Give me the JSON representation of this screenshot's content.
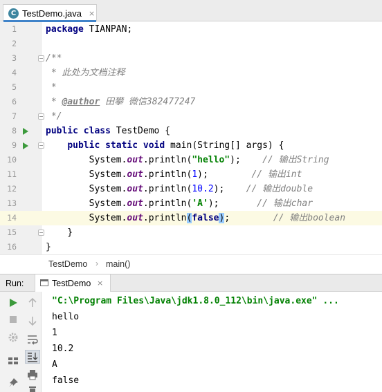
{
  "editor_tab": {
    "icon_letter": "C",
    "label": "TestDemo.java",
    "close": "×"
  },
  "code_lines": [
    {
      "n": "1",
      "segments": [
        [
          "kw",
          "package"
        ],
        [
          "",
          " TIANPAN;"
        ]
      ]
    },
    {
      "n": "2",
      "segments": []
    },
    {
      "n": "3",
      "segments": [
        [
          "doc",
          "/**"
        ]
      ]
    },
    {
      "n": "4",
      "segments": [
        [
          "doc",
          " * 此处为文档注释"
        ]
      ]
    },
    {
      "n": "5",
      "segments": [
        [
          "doc",
          " *"
        ]
      ]
    },
    {
      "n": "6",
      "segments": [
        [
          "doc",
          " * "
        ],
        [
          "doctag",
          "@author"
        ],
        [
          "doc",
          " 田攀 微信382477247"
        ]
      ]
    },
    {
      "n": "7",
      "segments": [
        [
          "doc",
          " */"
        ]
      ]
    },
    {
      "n": "8",
      "segments": [
        [
          "kw",
          "public class"
        ],
        [
          "",
          " TestDemo {"
        ]
      ]
    },
    {
      "n": "9",
      "segments": [
        [
          "",
          "    "
        ],
        [
          "kw",
          "public static void"
        ],
        [
          "",
          " main(String[] args) {"
        ]
      ]
    },
    {
      "n": "10",
      "segments": [
        [
          "",
          "        System."
        ],
        [
          "fld",
          "out"
        ],
        [
          "",
          ".println("
        ],
        [
          "str",
          "\"hello\""
        ],
        [
          "",
          ");    "
        ],
        [
          "cmt",
          "// 输出String"
        ]
      ]
    },
    {
      "n": "11",
      "segments": [
        [
          "",
          "        System."
        ],
        [
          "fld",
          "out"
        ],
        [
          "",
          ".println("
        ],
        [
          "num",
          "1"
        ],
        [
          "",
          ");        "
        ],
        [
          "cmt",
          "// 输出int"
        ]
      ]
    },
    {
      "n": "12",
      "segments": [
        [
          "",
          "        System."
        ],
        [
          "fld",
          "out"
        ],
        [
          "",
          ".println("
        ],
        [
          "num",
          "10.2"
        ],
        [
          "",
          ");    "
        ],
        [
          "cmt",
          "// 输出double"
        ]
      ]
    },
    {
      "n": "13",
      "segments": [
        [
          "",
          "        System."
        ],
        [
          "fld",
          "out"
        ],
        [
          "",
          ".println("
        ],
        [
          "str",
          "'A'"
        ],
        [
          "",
          ");       "
        ],
        [
          "cmt",
          "// 输出char"
        ]
      ]
    },
    {
      "n": "14",
      "segments": [
        [
          "",
          "        System."
        ],
        [
          "fld",
          "out"
        ],
        [
          "",
          ".println"
        ],
        [
          "brace-hl",
          "("
        ],
        [
          "kw",
          "false"
        ],
        [
          "brace-hl",
          ")"
        ],
        [
          "",
          ";        "
        ],
        [
          "cmt",
          "// 输出boolean"
        ]
      ]
    },
    {
      "n": "15",
      "segments": [
        [
          "",
          "    }"
        ]
      ]
    },
    {
      "n": "16",
      "segments": [
        [
          "",
          "}"
        ]
      ]
    }
  ],
  "breadcrumb": {
    "items": [
      "TestDemo",
      "main()"
    ],
    "separator": "›"
  },
  "run_window": {
    "label": "Run:",
    "tab_label": "TestDemo",
    "tab_close": "×"
  },
  "console_lines": [
    "\"C:\\Program Files\\Java\\jdk1.8.0_112\\bin\\java.exe\" ...",
    "hello",
    "1",
    "10.2",
    "A",
    "false"
  ],
  "colors": {
    "keyword": "#000080",
    "string": "#008000",
    "number": "#0000ff",
    "comment": "#808080",
    "field": "#660e7a",
    "current_line": "#fcfae3",
    "run_green": "#3c9a3c",
    "active_tab_underline": "#4083c9"
  },
  "icons": {
    "class_file": "class-c-icon",
    "run_gutter": "run-arrow-icon",
    "fold": "fold-icon",
    "run_tab": "console-icon",
    "toolbar": [
      "rerun-icon",
      "scroll-up-icon",
      "stop-icon",
      "scroll-down-icon",
      "settings-icon",
      "soft-wrap-icon",
      "layout-icon",
      "scroll-to-end-icon",
      "pin-icon",
      "print-icon",
      "trash-icon"
    ]
  }
}
